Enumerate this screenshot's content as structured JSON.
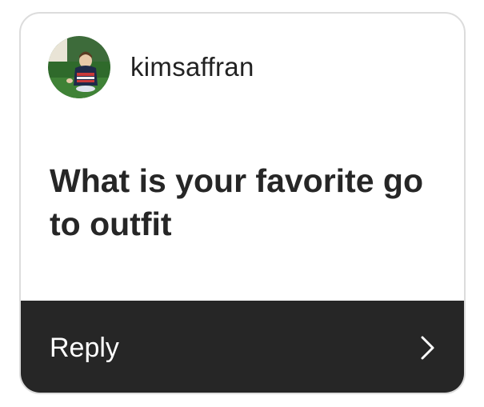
{
  "story_question_card": {
    "username": "kimsaffran",
    "question": "What is your favorite go to outfit",
    "reply_label": "Reply"
  },
  "icons": {
    "avatar": "profile-photo",
    "reply_arrow": "chevron-right-icon"
  },
  "colors": {
    "reply_bar": "#262626",
    "text_dark": "#262626",
    "card_border": "#dcdcdc"
  }
}
